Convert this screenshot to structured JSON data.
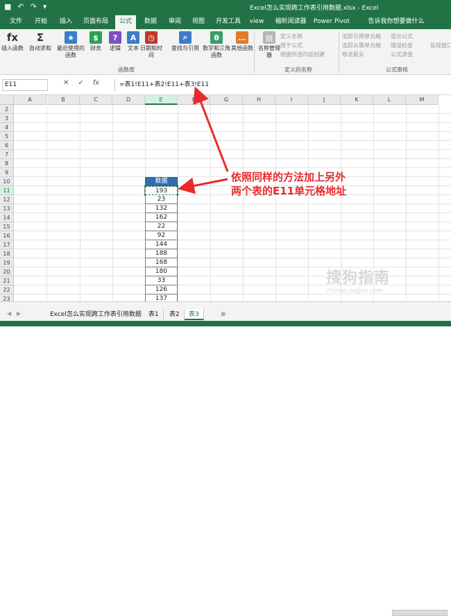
{
  "window": {
    "title": "Excel怎么实现跨工作表引用数据.xlsx - Excel"
  },
  "quick_access": {
    "save": "■",
    "undo": "↶",
    "redo": "↷",
    "more": "▾"
  },
  "tabs": [
    "文件",
    "开始",
    "插入",
    "页面布局",
    "公式",
    "数据",
    "审阅",
    "视图",
    "开发工具",
    "view",
    "福昕阅读器",
    "Power Pivot",
    "告诉我你想要做什么"
  ],
  "active_tab": "公式",
  "ribbon": {
    "buttons": [
      {
        "label": "插入函数",
        "icon": "fx",
        "color": "#444444"
      },
      {
        "label": "自动求和",
        "icon": "Σ",
        "color": "#444444"
      },
      {
        "label": "最近使用的函数",
        "icon": "★",
        "color": "#3d7cc9"
      },
      {
        "label": "财务",
        "icon": "$",
        "color": "#2f9e5a"
      },
      {
        "label": "逻辑",
        "icon": "?",
        "color": "#7d4fc2"
      },
      {
        "label": "文本",
        "icon": "A",
        "color": "#3d7cc9"
      },
      {
        "label": "日期和时间",
        "icon": "◷",
        "color": "#c0392b"
      },
      {
        "label": "查找与引用",
        "icon": "⌕",
        "color": "#3d7cc9"
      },
      {
        "label": "数学和三角函数",
        "icon": "θ",
        "color": "#3a9c6b"
      },
      {
        "label": "其他函数",
        "icon": "…",
        "color": "#e07b2c"
      },
      {
        "label": "名称管理器",
        "icon": "▤",
        "color": "#b5b5b5"
      }
    ],
    "group_function_library": "函数库",
    "group_defined_names": "定义的名称",
    "group_formula_auditing": "公式审核",
    "defined_names_items": [
      "定义名称",
      "用于公式",
      "根据所选内容创建"
    ],
    "auditing_items": [
      "追踪引用单元格",
      "追踪从属单元格",
      "移去箭头",
      "显示公式",
      "错误检查",
      "公式求值",
      "监视窗口"
    ]
  },
  "formula_bar": {
    "name_box": "E11",
    "cancel": "✕",
    "enter": "✓",
    "fx": "fx",
    "formula": "=表1!E11+表2!E11+表3!E11"
  },
  "columns": [
    "A",
    "B",
    "C",
    "D",
    "E",
    "F",
    "G",
    "H",
    "I",
    "J",
    "K",
    "L",
    "M"
  ],
  "rows": [
    2,
    3,
    4,
    5,
    6,
    7,
    8,
    9,
    10,
    11,
    12,
    13,
    14,
    15,
    16,
    17,
    18,
    19,
    20,
    21,
    22,
    23
  ],
  "column_e": {
    "header": "数据",
    "values": [
      "193",
      "23",
      "132",
      "162",
      "22",
      "92",
      "144",
      "188",
      "168",
      "180",
      "33",
      "126",
      "137"
    ]
  },
  "annotation": {
    "line1": "依照同样的方法加上另外",
    "line2": "两个表的E11单元格地址",
    "color": "#e82a2a"
  },
  "sheets": [
    "Excel怎么实现跨工作表引用数据",
    "表1",
    "表2",
    "表3"
  ],
  "active_sheet": "表3",
  "add_sheet": "⊕",
  "watermark": {
    "main": "搜狗指南",
    "sub": "zhinan.sogou.com"
  },
  "colors": {
    "excel_green": "#217346",
    "header_blue": "#2f6db3"
  }
}
